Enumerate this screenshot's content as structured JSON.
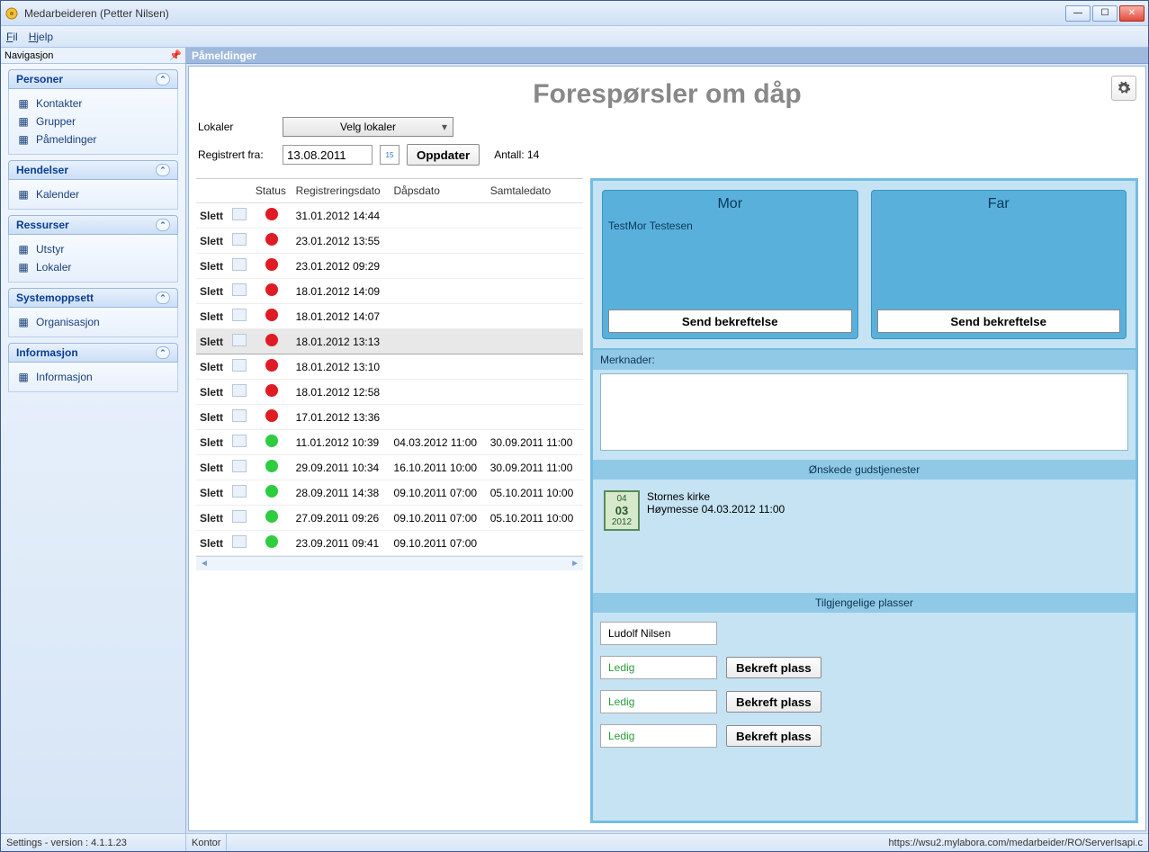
{
  "window": {
    "title": "Medarbeideren (Petter Nilsen)"
  },
  "menu": {
    "file": "Fil",
    "help": "Hjelp"
  },
  "nav": {
    "header": "Navigasjon",
    "groups": [
      {
        "title": "Personer",
        "items": [
          {
            "label": "Kontakter",
            "icon": "contacts-icon"
          },
          {
            "label": "Grupper",
            "icon": "groups-icon"
          },
          {
            "label": "Påmeldinger",
            "icon": "signup-icon"
          }
        ]
      },
      {
        "title": "Hendelser",
        "items": [
          {
            "label": "Kalender",
            "icon": "calendar-icon"
          }
        ]
      },
      {
        "title": "Ressurser",
        "items": [
          {
            "label": "Utstyr",
            "icon": "equipment-icon"
          },
          {
            "label": "Lokaler",
            "icon": "location-icon"
          }
        ]
      },
      {
        "title": "Systemoppsett",
        "items": [
          {
            "label": "Organisasjon",
            "icon": "org-icon"
          }
        ]
      },
      {
        "title": "Informasjon",
        "items": [
          {
            "label": "Informasjon",
            "icon": "info-icon"
          }
        ]
      }
    ]
  },
  "tab": "Påmeldinger",
  "page": {
    "title": "Forespørsler om dåp",
    "lokaler_label": "Lokaler",
    "lokaler_value": "Velg lokaler",
    "reg_label": "Registrert fra:",
    "reg_value": "13.08.2011",
    "update_btn": "Oppdater",
    "count_label": "Antall: 14"
  },
  "table": {
    "headers": {
      "status": "Status",
      "reg": "Registreringsdato",
      "dap": "Dåpsdato",
      "sam": "Samtaledato"
    },
    "slett": "Slett",
    "rows": [
      {
        "status": "red",
        "reg": "31.01.2012 14:44",
        "dap": "",
        "sam": "",
        "sel": false
      },
      {
        "status": "red",
        "reg": "23.01.2012 13:55",
        "dap": "",
        "sam": "",
        "sel": false
      },
      {
        "status": "red",
        "reg": "23.01.2012 09:29",
        "dap": "",
        "sam": "",
        "sel": false
      },
      {
        "status": "red",
        "reg": "18.01.2012 14:09",
        "dap": "",
        "sam": "",
        "sel": false
      },
      {
        "status": "red",
        "reg": "18.01.2012 14:07",
        "dap": "",
        "sam": "",
        "sel": false
      },
      {
        "status": "red",
        "reg": "18.01.2012 13:13",
        "dap": "",
        "sam": "",
        "sel": true
      },
      {
        "status": "red",
        "reg": "18.01.2012 13:10",
        "dap": "",
        "sam": "",
        "sel": false
      },
      {
        "status": "red",
        "reg": "18.01.2012 12:58",
        "dap": "",
        "sam": "",
        "sel": false
      },
      {
        "status": "red",
        "reg": "17.01.2012 13:36",
        "dap": "",
        "sam": "",
        "sel": false
      },
      {
        "status": "green",
        "reg": "11.01.2012 10:39",
        "dap": "04.03.2012 11:00",
        "sam": "30.09.2011 11:00",
        "sel": false
      },
      {
        "status": "green",
        "reg": "29.09.2011 10:34",
        "dap": "16.10.2011 10:00",
        "sam": "30.09.2011 11:00",
        "sel": false
      },
      {
        "status": "green",
        "reg": "28.09.2011 14:38",
        "dap": "09.10.2011 07:00",
        "sam": "05.10.2011 10:00",
        "sel": false
      },
      {
        "status": "green",
        "reg": "27.09.2011 09:26",
        "dap": "09.10.2011 07:00",
        "sam": "05.10.2011 10:00",
        "sel": false
      },
      {
        "status": "green",
        "reg": "23.09.2011 09:41",
        "dap": "09.10.2011 07:00",
        "sam": "",
        "sel": false
      }
    ]
  },
  "detail": {
    "mor": {
      "title": "Mor",
      "name": "TestMor   Testesen",
      "btn": "Send bekreftelse"
    },
    "far": {
      "title": "Far",
      "name": "",
      "btn": "Send bekreftelse"
    },
    "merknader_label": "Merknader:",
    "onskede_title": "Ønskede gudstjenester",
    "service": {
      "d1": "04",
      "d2": "03",
      "y": "2012",
      "place": "Stornes kirke",
      "desc": "Høymesse  04.03.2012 11:00"
    },
    "places_title": "Tilgjengelige plasser",
    "confirmed": "Ludolf Nilsen",
    "free_label": "Ledig",
    "confirm_btn": "Bekreft plass"
  },
  "status": {
    "left": "Settings - version : 4.1.1.23",
    "mid": "Kontor",
    "url": "https://wsu2.mylabora.com/medarbeider/RO/ServerIsapi.c"
  }
}
